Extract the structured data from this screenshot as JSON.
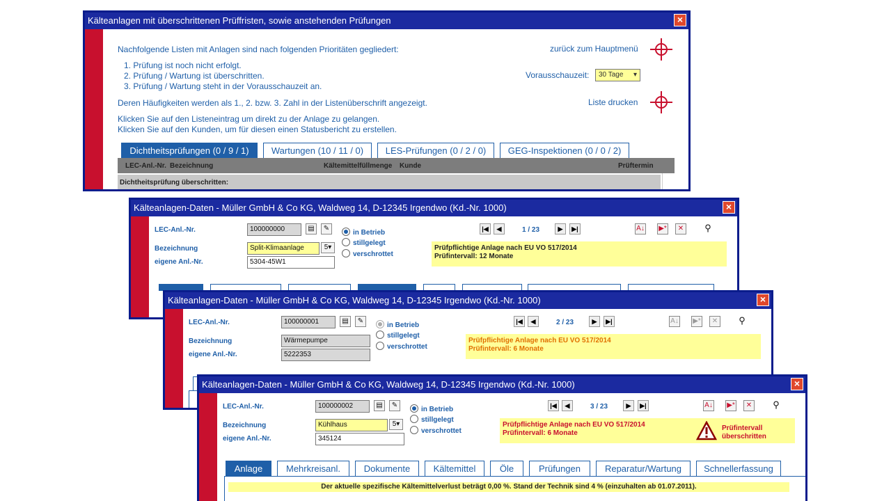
{
  "main": {
    "title": "Kälteanlagen mit überschrittenen Prüffristen, sowie anstehenden Prüfungen",
    "intro": "Nachfolgende Listen mit Anlagen sind nach folgenden Prioritäten gegliedert:",
    "list_items": [
      "1. Prüfung ist noch nicht erfolgt.",
      "2. Prüfung / Wartung ist überschritten.",
      "3. Prüfung / Wartung steht in der Vorausschauzeit an."
    ],
    "frequency_text": "Deren Häufigkeiten werden als 1., 2. bzw. 3. Zahl in der Listenüberschrift angezeigt.",
    "click_text_1": "Klicken Sie auf den Listeneintrag um direkt zu der Anlage zu gelangen.",
    "click_text_2": "Klicken Sie auf den Kunden, um für diesen einen Statusbericht zu erstellen.",
    "back_link": "zurück zum Hauptmenü",
    "preview_label": "Vorausschauzeit:",
    "preview_value": "30 Tage",
    "print_link": "Liste drucken",
    "tabs": [
      "Dichtheitsprüfungen (0 / 9 / 1)",
      "Wartungen (10 / 11 / 0)",
      "LES-Prüfungen (0 / 2 / 0)",
      "GEG-Inspektionen (0 / 0 / 2)"
    ],
    "table_headers": [
      "LEC-Anl.-Nr.",
      "Bezeichnung",
      "Kältemittelfüllmenge",
      "Kunde",
      "Prüftermin"
    ],
    "section_row": "Dichtheitsprüfung überschritten:"
  },
  "detail_title": "Kälteanlagen-Daten - Müller GmbH & Co KG, Waldweg 14, D-12345 Irgendwo (Kd.-Nr. 1000)",
  "labels": {
    "lec": "LEC-Anl.-Nr.",
    "bezeichnung": "Bezeichnung",
    "eigene": "eigene Anl.-Nr."
  },
  "status_options": [
    "in Betrieb",
    "stillgelegt",
    "verschrottet"
  ],
  "note_line_1": "Prüfpflichtige Anlage nach EU VO 517/2014",
  "windows": [
    {
      "lec": "100000000",
      "bezeichnung": "Split-Klimaanlage",
      "eigene": "5304-45W1",
      "page": "1 / 23",
      "note_line_2": "Prüfintervall: 12 Monate"
    },
    {
      "lec": "100000001",
      "bezeichnung": "Wärmepumpe",
      "eigene": "5222353",
      "page": "2 / 23",
      "note_line_2": "Prüfintervall: 6 Monate"
    },
    {
      "lec": "100000002",
      "bezeichnung": "Kühlhaus",
      "eigene": "345124",
      "page": "3 / 23",
      "note_line_2": "Prüfintervall: 6 Monate",
      "warning_1": "Prüfintervall",
      "warning_2": "überschritten"
    }
  ],
  "bottom_tabs": [
    "Anlage",
    "Mehrkreisanl.",
    "Dokumente",
    "Kältemittel",
    "Öle",
    "Prüfungen",
    "Reparatur/Wartung",
    "Schnellerfassung"
  ],
  "bottom_info": "Der aktuelle spezifische Kältemittelverlust beträgt 0,00 %. Stand der Technik sind 4 % (einzuhalten ab 01.07.2011).",
  "colors": {
    "title_bar": "#1b2aa0",
    "accent_red": "#c8102e",
    "link_blue": "#1f5fa8",
    "note_yellow": "#ffff99"
  }
}
